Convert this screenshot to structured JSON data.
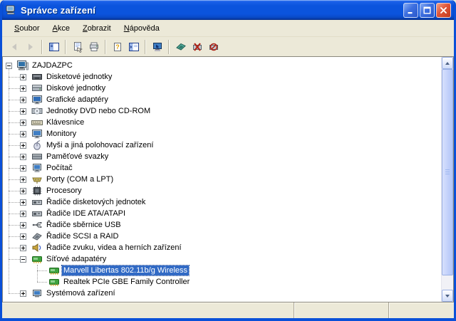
{
  "window": {
    "title": "Správce zařízení",
    "controls": [
      {
        "name": "minimize"
      },
      {
        "name": "maximize"
      },
      {
        "name": "close"
      }
    ]
  },
  "menu": {
    "items": [
      {
        "label": "Soubor",
        "underline": 0
      },
      {
        "label": "Akce",
        "underline": 0
      },
      {
        "label": "Zobrazit",
        "underline": 0
      },
      {
        "label": "Nápověda",
        "underline": 0
      }
    ]
  },
  "toolbar": {
    "buttons": [
      {
        "icon": "back",
        "disabled": true
      },
      {
        "icon": "forward",
        "disabled": true
      },
      {
        "type": "separator"
      },
      {
        "icon": "show-hide-tree"
      },
      {
        "type": "separator"
      },
      {
        "icon": "properties"
      },
      {
        "icon": "print"
      },
      {
        "type": "separator"
      },
      {
        "icon": "help"
      },
      {
        "icon": "show-hide-pane"
      },
      {
        "type": "separator"
      },
      {
        "icon": "scan-hardware-changes"
      },
      {
        "type": "separator"
      },
      {
        "icon": "update-driver"
      },
      {
        "icon": "uninstall"
      },
      {
        "icon": "disable"
      }
    ]
  },
  "tree": {
    "items": [
      {
        "label": "ZAJDAZPC",
        "icon": "computer",
        "level": 0,
        "expand": "collapse"
      },
      {
        "label": "Disketové jednotky",
        "icon": "floppy-drive",
        "level": 1,
        "expand": "expand"
      },
      {
        "label": "Diskové jednotky",
        "icon": "disk-drive",
        "level": 1,
        "expand": "expand"
      },
      {
        "label": "Grafické adaptéry",
        "icon": "display-adapter",
        "level": 1,
        "expand": "expand"
      },
      {
        "label": "Jednotky DVD nebo CD-ROM",
        "icon": "cd-drive",
        "level": 1,
        "expand": "expand"
      },
      {
        "label": "Klávesnice",
        "icon": "keyboard",
        "level": 1,
        "expand": "expand"
      },
      {
        "label": "Monitory",
        "icon": "monitor",
        "level": 1,
        "expand": "expand"
      },
      {
        "label": "Myši a jiná polohovací zařízení",
        "icon": "mouse",
        "level": 1,
        "expand": "expand"
      },
      {
        "label": "Paměťové svazky",
        "icon": "storage-volume",
        "level": 1,
        "expand": "expand"
      },
      {
        "label": "Počítač",
        "icon": "computer-system",
        "level": 1,
        "expand": "expand"
      },
      {
        "label": "Porty (COM a LPT)",
        "icon": "port",
        "level": 1,
        "expand": "expand"
      },
      {
        "label": "Procesory",
        "icon": "processor",
        "level": 1,
        "expand": "expand"
      },
      {
        "label": "Řadiče disketových jednotek",
        "icon": "controller",
        "level": 1,
        "expand": "expand"
      },
      {
        "label": "Řadiče IDE ATA/ATAPI",
        "icon": "controller",
        "level": 1,
        "expand": "expand"
      },
      {
        "label": "Řadiče sběrnice USB",
        "icon": "usb",
        "level": 1,
        "expand": "expand"
      },
      {
        "label": "Řadiče SCSI a RAID",
        "icon": "scsi",
        "level": 1,
        "expand": "expand"
      },
      {
        "label": "Řadiče zvuku, videa a herních zařízení",
        "icon": "audio",
        "level": 1,
        "expand": "expand"
      },
      {
        "label": "Síťové adapatéry",
        "icon": "network-adapter",
        "level": 1,
        "expand": "collapse"
      },
      {
        "label": "Marvell Libertas 802.11b/g Wireless",
        "icon": "network-adapter",
        "level": 2,
        "selected": true
      },
      {
        "label": "Realtek PCIe GBE Family Controller",
        "icon": "network-adapter",
        "level": 2
      },
      {
        "label": "Systémová zařízení",
        "icon": "system-devices",
        "level": 1,
        "expand": "expand"
      }
    ]
  },
  "statusbar": {
    "sections": [
      "",
      "",
      ""
    ]
  },
  "colors": {
    "titlebar_blue": "#0b54dd",
    "window_border": "#0a50d8",
    "chrome": "#ece9d8",
    "selection": "#316ac5",
    "selection_text": "#ffffff",
    "tree_background": "#ffffff"
  }
}
